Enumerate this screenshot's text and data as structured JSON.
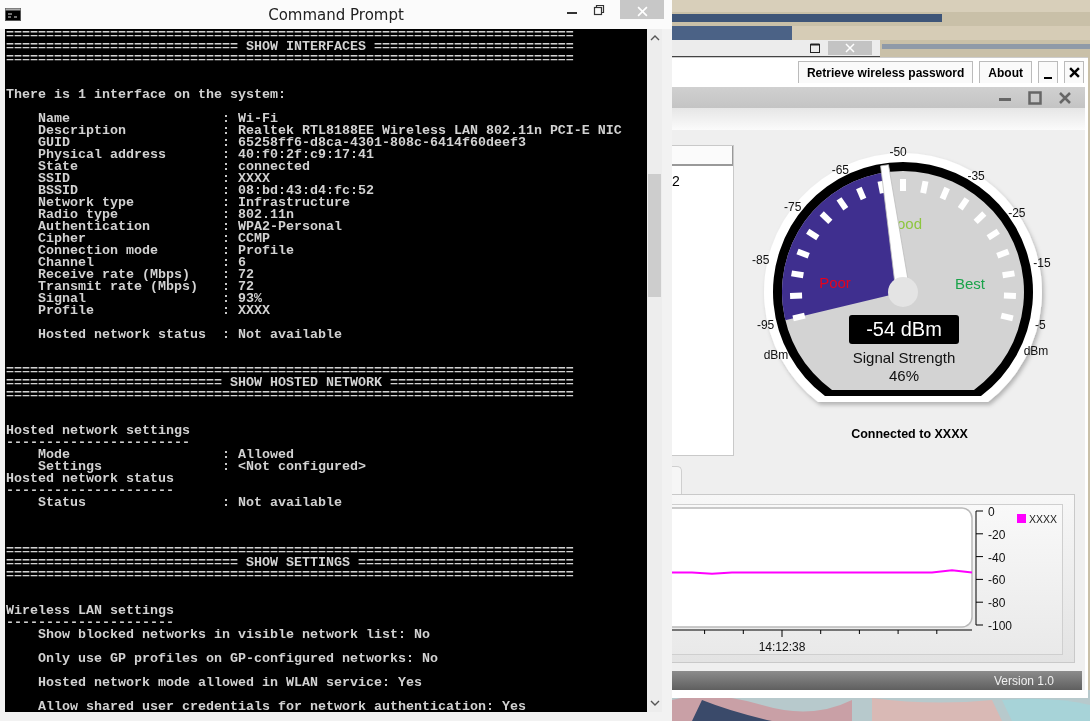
{
  "console_window": {
    "title": "Command Prompt",
    "lines": [
      {
        "kind": "text",
        "text": "======================================================================="
      },
      {
        "kind": "text",
        "text": "============================= SHOW INTERFACES ========================="
      },
      {
        "kind": "text",
        "text": "======================================================================="
      },
      {
        "kind": "blank"
      },
      {
        "kind": "blank"
      },
      {
        "kind": "text",
        "text": "There is 1 interface on the system:"
      },
      {
        "kind": "blank"
      },
      {
        "kind": "text",
        "text": "    Name                   : Wi-Fi"
      },
      {
        "kind": "text",
        "text": "    Description            : Realtek RTL8188EE Wireless LAN 802.11n PCI-E NIC"
      },
      {
        "kind": "text",
        "text": "    GUID                   : 65258ff6-d8ca-4301-808c-6414f60deef3"
      },
      {
        "kind": "text",
        "text": "    Physical address       : 40:f0:2f:c9:17:41"
      },
      {
        "kind": "text",
        "text": "    State                  : connected"
      },
      {
        "kind": "text",
        "text": "    SSID                   : XXXX"
      },
      {
        "kind": "text",
        "text": "    BSSID                  : 08:bd:43:d4:fc:52"
      },
      {
        "kind": "text",
        "text": "    Network type           : Infrastructure"
      },
      {
        "kind": "text",
        "text": "    Radio type             : 802.11n"
      },
      {
        "kind": "text",
        "text": "    Authentication         : WPA2-Personal"
      },
      {
        "kind": "text",
        "text": "    Cipher                 : CCMP"
      },
      {
        "kind": "text",
        "text": "    Connection mode        : Profile"
      },
      {
        "kind": "text",
        "text": "    Channel                : 6"
      },
      {
        "kind": "text",
        "text": "    Receive rate (Mbps)    : 72"
      },
      {
        "kind": "text",
        "text": "    Transmit rate (Mbps)   : 72"
      },
      {
        "kind": "text",
        "text": "    Signal                 : 93%"
      },
      {
        "kind": "text",
        "text": "    Profile                : XXXX"
      },
      {
        "kind": "blank"
      },
      {
        "kind": "text",
        "text": "    Hosted network status  : Not available"
      },
      {
        "kind": "blank"
      },
      {
        "kind": "blank"
      },
      {
        "kind": "text",
        "text": "======================================================================="
      },
      {
        "kind": "text",
        "text": "=========================== SHOW HOSTED NETWORK ======================="
      },
      {
        "kind": "text",
        "text": "======================================================================="
      },
      {
        "kind": "blank"
      },
      {
        "kind": "blank"
      },
      {
        "kind": "text",
        "text": "Hosted network settings"
      },
      {
        "kind": "text",
        "text": "-----------------------"
      },
      {
        "kind": "text",
        "text": "    Mode                   : Allowed"
      },
      {
        "kind": "text",
        "text": "    Settings               : <Not configured>"
      },
      {
        "kind": "text",
        "text": "Hosted network status"
      },
      {
        "kind": "text",
        "text": "---------------------"
      },
      {
        "kind": "text",
        "text": "    Status                 : Not available"
      },
      {
        "kind": "blank"
      },
      {
        "kind": "blank"
      },
      {
        "kind": "blank"
      },
      {
        "kind": "text",
        "text": "======================================================================="
      },
      {
        "kind": "text",
        "text": "============================= SHOW SETTINGS ==========================="
      },
      {
        "kind": "text",
        "text": "======================================================================="
      },
      {
        "kind": "blank"
      },
      {
        "kind": "blank"
      },
      {
        "kind": "text",
        "text": "Wireless LAN settings"
      },
      {
        "kind": "text",
        "text": "---------------------"
      },
      {
        "kind": "text",
        "text": "    Show blocked networks in visible network list: No"
      },
      {
        "kind": "blank"
      },
      {
        "kind": "text",
        "text": "    Only use GP profiles on GP-configured networks: No"
      },
      {
        "kind": "blank"
      },
      {
        "kind": "text",
        "text": "    Hosted network mode allowed in WLAN service: Yes"
      },
      {
        "kind": "blank"
      },
      {
        "kind": "text",
        "text": "    Allow shared user credentials for network authentication: Yes"
      }
    ]
  },
  "app_window": {
    "buttons": [
      "Retrieve wireless password",
      "About"
    ]
  },
  "meter_window": {
    "list": {
      "items": [
        "2"
      ]
    },
    "gauge": {
      "scale": [
        "-95",
        "-85",
        "-75",
        "-65",
        "-50",
        "-35",
        "-25",
        "-15",
        "-5"
      ],
      "units": [
        "dBm",
        "dBm"
      ],
      "zones": [
        {
          "label": "Poor",
          "color": "#e8001c"
        },
        {
          "label": "ood",
          "color": "#8dc63f"
        },
        {
          "label": "Best",
          "color": "#1aa34a"
        }
      ],
      "reading": "-54 dBm",
      "caption": "Signal Strength",
      "percent": "46%"
    },
    "status": "Connected to XXXX",
    "chart": {
      "time_label": "14:12:38",
      "chart_data": {
        "type": "line",
        "ylim": [
          -100,
          0
        ],
        "yticks": [
          0,
          -20,
          -40,
          -60,
          -80,
          -100
        ],
        "series": [
          {
            "name": "XXXX",
            "color": "#ff00ff",
            "values": [
              -54,
              -54,
              -55,
              -54,
              -54,
              -54,
              -54,
              -54,
              -54,
              -54,
              -54,
              -54,
              -54,
              -54,
              -52,
              -54
            ]
          }
        ]
      }
    },
    "version": "Version 1.0"
  }
}
